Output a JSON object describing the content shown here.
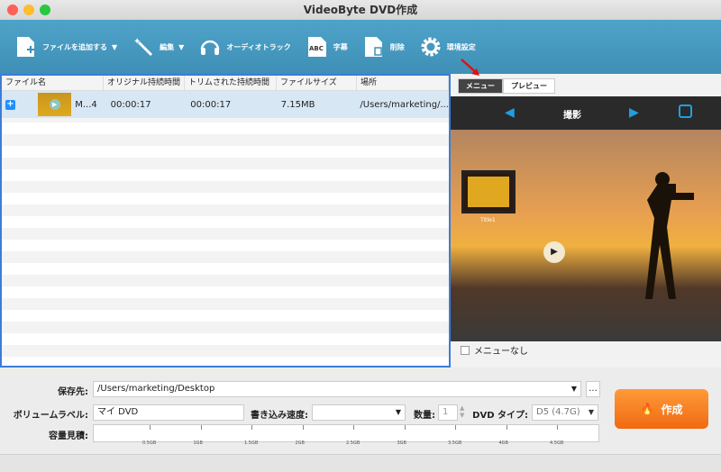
{
  "window": {
    "title": "VideoByte DVD作成"
  },
  "toolbar": {
    "add_file": "ファイルを追加する",
    "edit": "編集",
    "audio_track": "オーディオトラック",
    "subtitle": "字幕",
    "delete": "削除",
    "settings": "環境設定",
    "abc": "ABC"
  },
  "table": {
    "headers": [
      "ファイル名",
      "オリジナル持続時間",
      "トリムされた持続時間",
      "ファイルサイズ",
      "場所"
    ],
    "rows": [
      {
        "name": "M...4",
        "original": "00:00:17",
        "trimmed": "00:00:17",
        "size": "7.15MB",
        "location": "/Users/marketing/..."
      }
    ]
  },
  "right": {
    "tab_menu": "メニュー",
    "tab_preview": "プレビュー",
    "template_name": "撮影",
    "title_label": "Title1",
    "no_menu": "メニューなし"
  },
  "bottom": {
    "save_label": "保存先:",
    "save_path": "/Users/marketing/Desktop",
    "volume_label": "ボリュームラベル:",
    "volume_value": "マイ DVD",
    "speed_label": "書き込み速度:",
    "speed_value": "",
    "count_label": "数量:",
    "count_value": "1",
    "dvd_type_label": "DVD タイプ:",
    "dvd_type_value": "D5 (4.7G)",
    "capacity_label": "容量見積:",
    "capacity_ticks": [
      "0.5GB",
      "1GB",
      "1.5GB",
      "2GB",
      "2.5GB",
      "3GB",
      "3.5GB",
      "4GB",
      "4.5GB"
    ],
    "more": "...",
    "create": "作成"
  }
}
